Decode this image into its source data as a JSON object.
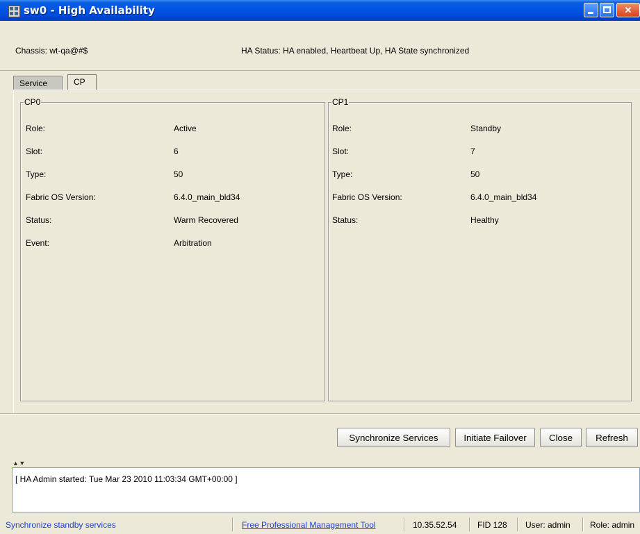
{
  "window": {
    "title": "sw0 - High Availability",
    "icon": "app-icon"
  },
  "info": {
    "chassis": "Chassis:  wt-qa@#$",
    "ha_status": "HA Status:  HA enabled, Heartbeat Up, HA State synchronized"
  },
  "tabs": [
    {
      "label": "Service",
      "active": false
    },
    {
      "label": "CP",
      "active": true
    }
  ],
  "cp0": {
    "title": "CP0",
    "rows": [
      {
        "label": "Role:",
        "value": "Active"
      },
      {
        "label": "Slot:",
        "value": "6"
      },
      {
        "label": "Type:",
        "value": "50"
      },
      {
        "label": "Fabric OS Version:",
        "value": "6.4.0_main_bld34"
      },
      {
        "label": "Status:",
        "value": "Warm Recovered"
      },
      {
        "label": "Event:",
        "value": "Arbitration"
      }
    ]
  },
  "cp1": {
    "title": "CP1",
    "rows": [
      {
        "label": "Role:",
        "value": "Standby"
      },
      {
        "label": "Slot:",
        "value": "7"
      },
      {
        "label": "Type:",
        "value": "50"
      },
      {
        "label": "Fabric OS Version:",
        "value": "6.4.0_main_bld34"
      },
      {
        "label": "Status:",
        "value": "Healthy"
      }
    ]
  },
  "buttons": {
    "synchronize": "Synchronize Services",
    "failover": "Initiate Failover",
    "close": "Close",
    "refresh": "Refresh"
  },
  "splitter": "▲ ▼",
  "log": {
    "line": "[ HA Admin started: Tue Mar 23 2010 11:03:34 GMT+00:00 ]"
  },
  "statusbar": {
    "hint": "Synchronize standby services",
    "link": "Free Professional Management Tool",
    "ip": "10.35.52.54",
    "fid": "FID 128",
    "user": "User: admin",
    "role": "Role: admin"
  },
  "colors": {
    "titlebar": "#0055e5",
    "link": "#2040c8",
    "window_bg": "#ece9d8"
  }
}
